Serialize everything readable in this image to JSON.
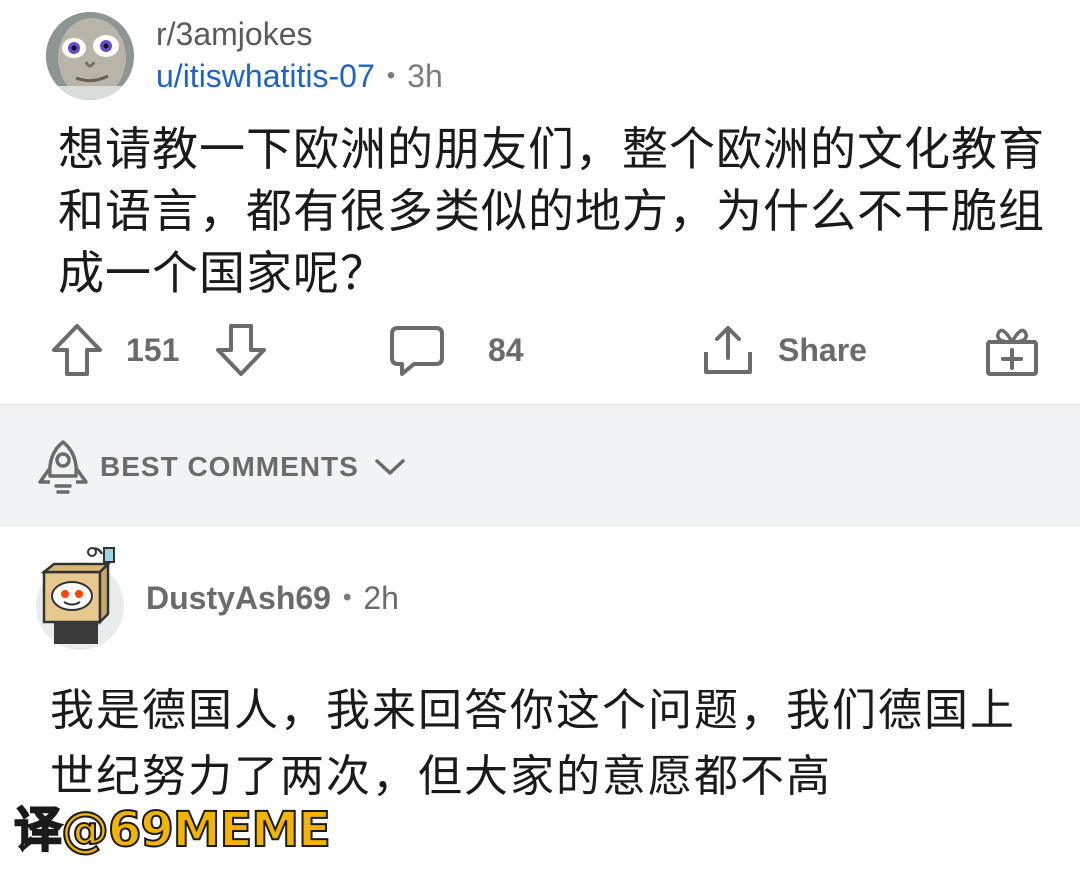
{
  "post": {
    "subreddit": "r/3amjokes",
    "username": "u/itiswhatitis-07",
    "separator": "•",
    "time": "3h",
    "text": "想请教一下欧洲的朋友们，整个欧洲的文化教育和语言，都有很多类似的地方，为什么不干脆组成一个国家呢？",
    "avatar_icon": "user-avatar-face"
  },
  "actions": {
    "upvote_icon": "upvote-arrow-icon",
    "score": "151",
    "downvote_icon": "downvote-arrow-icon",
    "comment_icon": "comment-bubble-icon",
    "comments": "84",
    "share_icon": "share-icon",
    "share_label": "Share",
    "award_icon": "gift-award-icon"
  },
  "sort": {
    "icon": "rocket-icon",
    "label": "BEST COMMENTS",
    "chevron": "chevron-down-icon"
  },
  "comment": {
    "username": "DustyAsh69",
    "separator": "•",
    "time": "2h",
    "text": "我是德国人，我来回答你这个问题，我们德国上世纪努力了两次，但大家的意愿都不高"
  },
  "watermark": "译@69MEME",
  "colors": {
    "link_blue": "#1e64c8",
    "muted": "#6b6b6b",
    "sortbar_bg": "#f2f3f5",
    "watermark": "#f2b400"
  }
}
